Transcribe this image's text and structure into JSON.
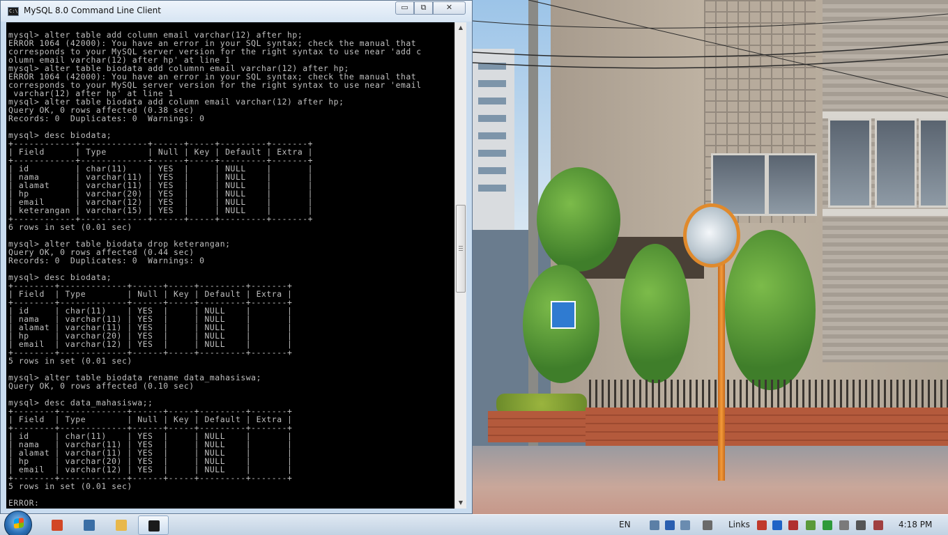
{
  "window": {
    "title": "MySQL 8.0 Command Line Client",
    "minimize_glyph": "▭",
    "maximize_glyph": "⧉",
    "close_glyph": "✕"
  },
  "console": {
    "lines": [
      "mysql> alter table add column email varchar(12) after hp;",
      "ERROR 1064 (42000): You have an error in your SQL syntax; check the manual that",
      "corresponds to your MySQL server version for the right syntax to use near 'add c",
      "olumn email varchar(12) after hp' at line 1",
      "mysql> alter table biodata add columnn email varchar(12) after hp;",
      "ERROR 1064 (42000): You have an error in your SQL syntax; check the manual that",
      "corresponds to your MySQL server version for the right syntax to use near 'email",
      " varchar(12) after hp' at line 1",
      "mysql> alter table biodata add column email varchar(12) after hp;",
      "Query OK, 0 rows affected (0.38 sec)",
      "Records: 0  Duplicates: 0  Warnings: 0",
      "",
      "mysql> desc biodata;",
      "+------------+-------------+------+-----+---------+-------+",
      "| Field      | Type        | Null | Key | Default | Extra |",
      "+------------+-------------+------+-----+---------+-------+",
      "| id         | char(11)    | YES  |     | NULL    |       |",
      "| nama       | varchar(11) | YES  |     | NULL    |       |",
      "| alamat     | varchar(11) | YES  |     | NULL    |       |",
      "| hp         | varchar(20) | YES  |     | NULL    |       |",
      "| email      | varchar(12) | YES  |     | NULL    |       |",
      "| keterangan | varchar(15) | YES  |     | NULL    |       |",
      "+------------+-------------+------+-----+---------+-------+",
      "6 rows in set (0.01 sec)",
      "",
      "mysql> alter table biodata drop keterangan;",
      "Query OK, 0 rows affected (0.44 sec)",
      "Records: 0  Duplicates: 0  Warnings: 0",
      "",
      "mysql> desc biodata;",
      "+--------+-------------+------+-----+---------+-------+",
      "| Field  | Type        | Null | Key | Default | Extra |",
      "+--------+-------------+------+-----+---------+-------+",
      "| id     | char(11)    | YES  |     | NULL    |       |",
      "| nama   | varchar(11) | YES  |     | NULL    |       |",
      "| alamat | varchar(11) | YES  |     | NULL    |       |",
      "| hp     | varchar(20) | YES  |     | NULL    |       |",
      "| email  | varchar(12) | YES  |     | NULL    |       |",
      "+--------+-------------+------+-----+---------+-------+",
      "5 rows in set (0.01 sec)",
      "",
      "mysql> alter table biodata rename data_mahasiswa;",
      "Query OK, 0 rows affected (0.10 sec)",
      "",
      "mysql> desc data_mahasiswa;;",
      "+--------+-------------+------+-----+---------+-------+",
      "| Field  | Type        | Null | Key | Default | Extra |",
      "+--------+-------------+------+-----+---------+-------+",
      "| id     | char(11)    | YES  |     | NULL    |       |",
      "| nama   | varchar(11) | YES  |     | NULL    |       |",
      "| alamat | varchar(11) | YES  |     | NULL    |       |",
      "| hp     | varchar(20) | YES  |     | NULL    |       |",
      "| email  | varchar(12) | YES  |     | NULL    |       |",
      "+--------+-------------+------+-----+---------+-------+",
      "5 rows in set (0.01 sec)",
      "",
      "ERROR:"
    ]
  },
  "scrollbar": {
    "up_glyph": "▲",
    "down_glyph": "▼"
  },
  "taskbar": {
    "pinned": [
      {
        "name": "powerpoint-icon",
        "color": "#d24726"
      },
      {
        "name": "keyboard-icon",
        "color": "#3a6ea5"
      },
      {
        "name": "folder-icon",
        "color": "#e8b84a"
      },
      {
        "name": "mysql-console-icon",
        "color": "#1b1b1b"
      }
    ],
    "language": "EN",
    "links_label": "Links",
    "clock": "4:18 PM",
    "tray_icons": [
      {
        "name": "keyboard-tray-icon",
        "color": "#5b7fa6"
      },
      {
        "name": "help-icon",
        "color": "#2a5fb0"
      },
      {
        "name": "network-tray-icon",
        "color": "#6a8cb0"
      },
      {
        "name": "notes-icon",
        "color": "#6a6a6a"
      },
      {
        "name": "red-app-icon",
        "color": "#c0392b"
      },
      {
        "name": "bluetooth-icon",
        "color": "#1f63c6"
      },
      {
        "name": "volume-muted-icon",
        "color": "#b03030"
      },
      {
        "name": "security-icon",
        "color": "#5a9a3a"
      },
      {
        "name": "green-arrow-icon",
        "color": "#2e9a3a"
      },
      {
        "name": "battery-icon",
        "color": "#7a7a7a"
      },
      {
        "name": "flag-icon",
        "color": "#555555"
      },
      {
        "name": "wifi-off-icon",
        "color": "#a04040"
      }
    ]
  }
}
